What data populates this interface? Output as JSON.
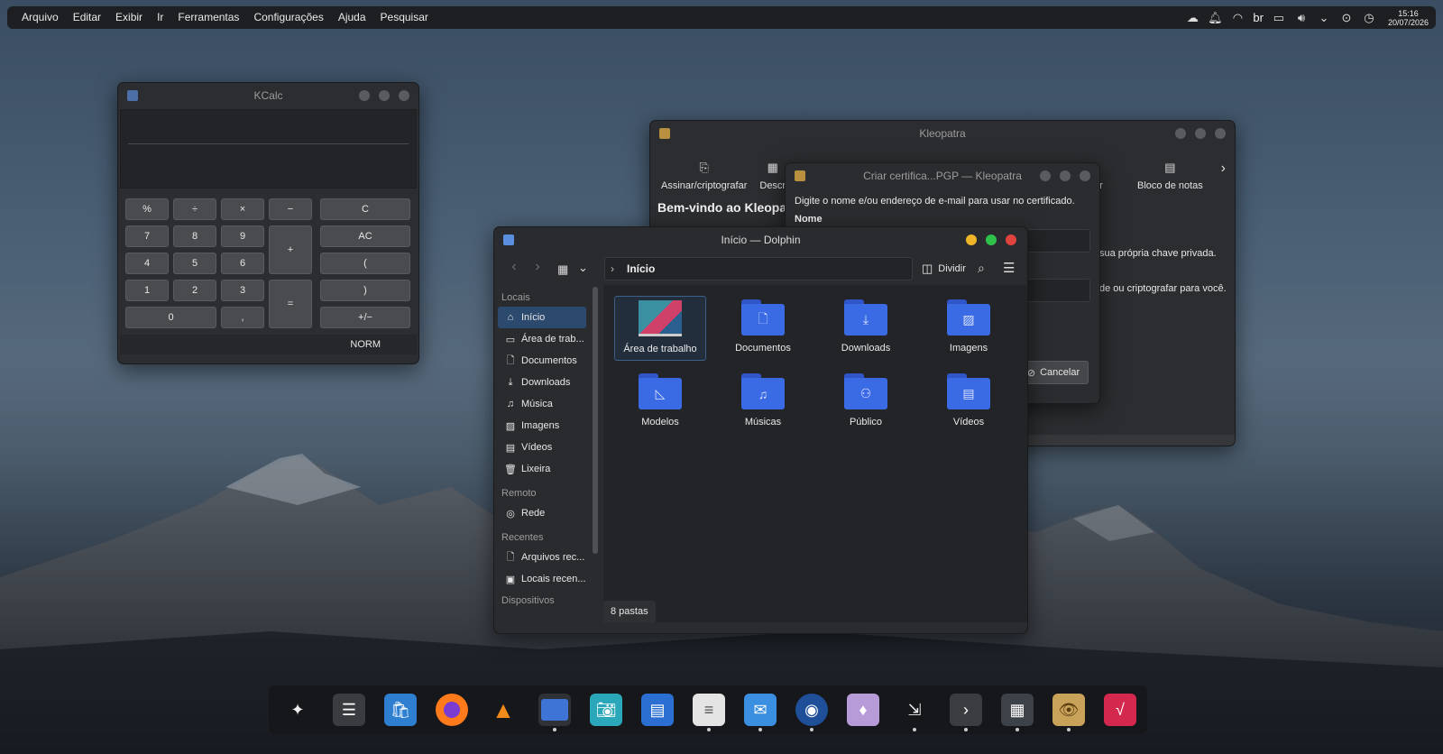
{
  "topbar": {
    "menu": [
      "Arquivo",
      "Editar",
      "Exibir",
      "Ir",
      "Ferramentas",
      "Configurações",
      "Ajuda",
      "Pesquisar"
    ],
    "tray_icons": [
      "weather-icon",
      "bell-icon",
      "wifi-icon",
      "keyboard-layout",
      "display-icon",
      "volume-icon",
      "chevron-down-icon",
      "account-icon",
      "clock-icon"
    ],
    "keyboard_layout": "br",
    "time": "15:16",
    "date": "20/07/2026"
  },
  "kcalc": {
    "title": "KCalc",
    "keys": {
      "percent": "%",
      "divide": "÷",
      "multiply": "×",
      "minus": "−",
      "clear": "C",
      "seven": "7",
      "eight": "8",
      "nine": "9",
      "plus": "+",
      "all_clear": "AC",
      "four": "4",
      "five": "5",
      "six": "6",
      "open_paren": "(",
      "one": "1",
      "two": "2",
      "three": "3",
      "equals": "=",
      "close_paren": ")",
      "zero": "0",
      "comma": ",",
      "sign": "+/−"
    },
    "mode": "NORM"
  },
  "kleopatra": {
    "title": "Kleopatra",
    "toolbar": [
      "Assinar/criptografar",
      "Descr",
      "vidor",
      "Bloco de notas"
    ],
    "welcome": "Bem-vindo ao Kleopat",
    "line1": "sua própria chave privada.",
    "line2": "de ou criptografar para você."
  },
  "cert_dialog": {
    "title": "Criar certifica...PGP — Kleopatra",
    "instruction": "Digite o nome e/ou endereço de e-mail para usar no certificado.",
    "name_label": "Nome",
    "name_value": "",
    "email_value": "",
    "cancel": "Cancelar"
  },
  "dolphin": {
    "title": "Início — Dolphin",
    "breadcrumb": "Início",
    "split_label": "Dividir",
    "sidebar": {
      "locais_header": "Locais",
      "locais": [
        "Início",
        "Área de trab...",
        "Documentos",
        "Downloads",
        "Música",
        "Imagens",
        "Vídeos",
        "Lixeira"
      ],
      "remoto_header": "Remoto",
      "remoto": [
        "Rede"
      ],
      "recentes_header": "Recentes",
      "recentes": [
        "Arquivos rec...",
        "Locais recen..."
      ],
      "dispositivos_header": "Dispositivos"
    },
    "folders": [
      "Área de trabalho",
      "Documentos",
      "Downloads",
      "Imagens",
      "Modelos",
      "Músicas",
      "Público",
      "Vídeos"
    ],
    "status": "8 pastas"
  },
  "dock": {
    "apps": [
      "kde-connect-icon",
      "system-settings-icon",
      "discover-icon",
      "firefox-icon",
      "vlc-icon",
      "dolphin-icon",
      "spectacle-icon",
      "writer-icon",
      "text-editor-icon",
      "kmail-icon",
      "camera-icon",
      "kpat-icon",
      "krfb-icon",
      "konsole-icon",
      "kcalc-icon",
      "kleopatra-icon",
      "kalgebra-icon"
    ]
  },
  "colors": {
    "accent": "#3b6be4",
    "selection": "#2c4a6e",
    "close": "#e0443e",
    "minimize": "#f0b429",
    "maximize": "#2fc24a"
  }
}
